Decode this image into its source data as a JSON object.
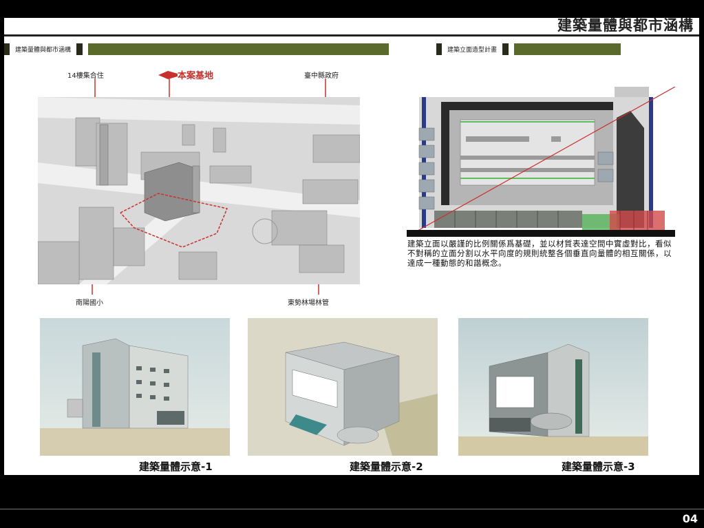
{
  "page": {
    "title": "建築量體與都市涵構",
    "page_number": "04"
  },
  "sections": {
    "left": "建築量體與都市涵構",
    "right": "建築立面造型計畫"
  },
  "callouts": {
    "housing": "14樓集合住",
    "site": "本案基地",
    "gov": "臺中縣政府",
    "school": "南陽國小",
    "forest": "東勢林場林管"
  },
  "description": "建築立面以嚴謹的比例關係爲基礎，並以材質表達空間中實虛對比，看似不對稱的立面分割以水平向度的規則統整各個垂直向量體的相互關係，以達成一種動態的和諧概念。",
  "captions": [
    "建築量體示意-1",
    "建築量體示意-2",
    "建築量體示意-3"
  ],
  "colors": {
    "accent_red": "#c8302c",
    "olive_bar": "#5a6a2a",
    "glass_green": "#4caf50"
  }
}
